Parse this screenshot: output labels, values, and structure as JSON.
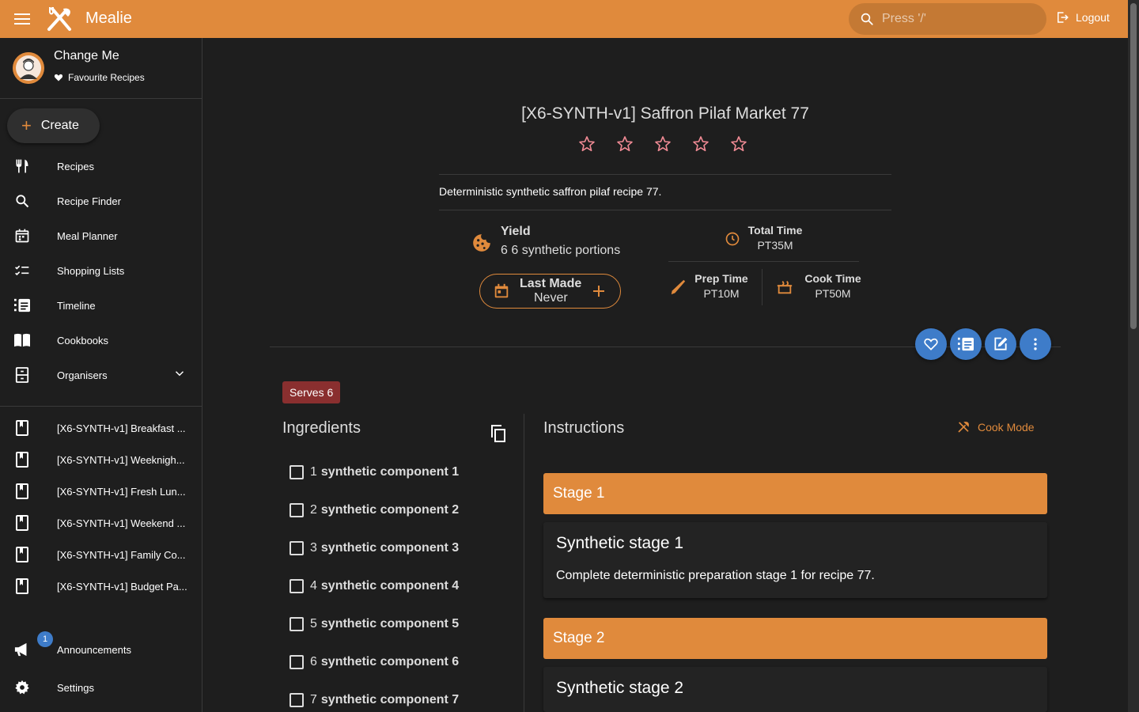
{
  "header": {
    "app_title": "Mealie",
    "search_placeholder": "Press '/'",
    "logout_label": "Logout",
    "accent_color": "#e08a3c"
  },
  "sidebar": {
    "user_name": "Change Me",
    "favourites_label": "Favourite Recipes",
    "create_label": "Create",
    "nav": [
      {
        "label": "Recipes",
        "icon": "fork-knife-icon"
      },
      {
        "label": "Recipe Finder",
        "icon": "search-icon"
      },
      {
        "label": "Meal Planner",
        "icon": "calendar-icon"
      },
      {
        "label": "Shopping Lists",
        "icon": "checklist-icon"
      },
      {
        "label": "Timeline",
        "icon": "timeline-icon"
      },
      {
        "label": "Cookbooks",
        "icon": "book-open-icon"
      },
      {
        "label": "Organisers",
        "icon": "organiser-icon"
      }
    ],
    "cookbooks": [
      "[X6-SYNTH-v1] Breakfast ...",
      "[X6-SYNTH-v1] Weeknigh...",
      "[X6-SYNTH-v1] Fresh Lun...",
      "[X6-SYNTH-v1] Weekend ...",
      "[X6-SYNTH-v1] Family Co...",
      "[X6-SYNTH-v1] Budget Pa..."
    ],
    "announcements_label": "Announcements",
    "announcements_count": "1",
    "settings_label": "Settings"
  },
  "recipe": {
    "title": "[X6-SYNTH-v1] Saffron Pilaf Market 77",
    "rating": 0,
    "rating_max": 5,
    "description": "Deterministic synthetic saffron pilaf recipe 77.",
    "yield_label": "Yield",
    "yield_value": "6 6 synthetic portions",
    "last_made_label": "Last Made",
    "last_made_value": "Never",
    "total_time_label": "Total Time",
    "total_time_value": "PT35M",
    "prep_time_label": "Prep Time",
    "prep_time_value": "PT10M",
    "cook_time_label": "Cook Time",
    "cook_time_value": "PT50M",
    "serves": "Serves 6"
  },
  "ingredients": {
    "title": "Ingredients",
    "items": [
      {
        "qty": "1",
        "name": "synthetic component 1"
      },
      {
        "qty": "2",
        "name": "synthetic component 2"
      },
      {
        "qty": "3",
        "name": "synthetic component 3"
      },
      {
        "qty": "4",
        "name": "synthetic component 4"
      },
      {
        "qty": "5",
        "name": "synthetic component 5"
      },
      {
        "qty": "6",
        "name": "synthetic component 6"
      },
      {
        "qty": "7",
        "name": "synthetic component 7"
      }
    ]
  },
  "instructions": {
    "title": "Instructions",
    "cook_mode_label": "Cook Mode",
    "stages": [
      {
        "header": "Stage 1",
        "title": "Synthetic stage 1",
        "text": "Complete deterministic preparation stage 1 for recipe 77."
      },
      {
        "header": "Stage 2",
        "title": "Synthetic stage 2",
        "text": ""
      }
    ]
  }
}
